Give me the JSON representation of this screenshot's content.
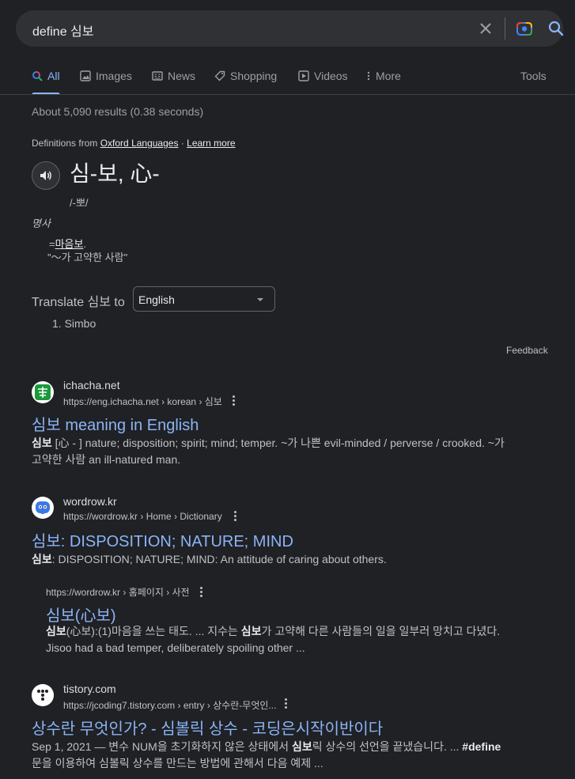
{
  "search": {
    "query": "define 심보"
  },
  "tabs": {
    "items": [
      "All",
      "Images",
      "News",
      "Shopping",
      "Videos",
      "More"
    ],
    "tools": "Tools"
  },
  "stats": "About 5,090 results (0.38 seconds)",
  "dictionary": {
    "source_prefix": "Definitions from",
    "source_name": "Oxford Languages",
    "separator": "·",
    "learn_more": "Learn more",
    "headword": "심-보, 心-",
    "phonetic": "/-뽀/",
    "part_of_speech": "명사",
    "def_prefix": "=",
    "def_link": "마음보",
    "def_suffix": ".",
    "example": "\"～가 고약한 사람\"",
    "translate_label": "Translate 심보 to",
    "language": "English",
    "translation": "1. Simbo",
    "feedback": "Feedback"
  },
  "results": [
    {
      "site": "ichacha.net",
      "url": "https://eng.ichacha.net › korean › 심보",
      "title": "심보 meaning in English",
      "snippet_bold": "심보",
      "snippet_rest": " [心 - ] nature; disposition; spirit; mind; temper. ~가 나쁜 evil-minded / perverse / crooked. ~가 고약한 사람 an ill-natured man."
    },
    {
      "site": "wordrow.kr",
      "url": "https://wordrow.kr › Home › Dictionary",
      "title": "심보: DISPOSITION; NATURE; MIND",
      "snippet_bold": "심보",
      "snippet_rest": ": DISPOSITION; NATURE; MIND: An attitude of caring about others.",
      "sub": {
        "url": "https://wordrow.kr › 홈페이지 › 사전",
        "title": "심보(心보)",
        "snippet_b1": "심보",
        "snippet_t1": "(心보):(1)마음을 쓰는 태도. ... 지수는 ",
        "snippet_b2": "심보",
        "snippet_t2": "가 고약해 다른 사람들의 일을 일부러 망치고 다녔다. Jisoo had a bad temper, deliberately spoiling other ..."
      }
    },
    {
      "site": "tistory.com",
      "url": "https://jcoding7.tistory.com › entry › 상수란-무엇인...",
      "title": "상수란 무엇인가? - 심볼릭 상수 - 코딩은시작이반이다",
      "snippet_t1": "Sep 1, 2021 — 변수 NUM을 초기화하지 않은 상태에서 ",
      "snippet_b1": "심보",
      "snippet_t2": "릭 상수의 선언을 끝냈습니다. ... ",
      "snippet_b2": "#define",
      "snippet_t3": " 문을 이용하여 심볼릭 상수를 만드는 방법에 관해서 다음 예제 ..."
    }
  ],
  "colors": {
    "background": "#202124",
    "link": "#8ab4f8",
    "text": "#bdc1c6",
    "searchbar": "#303134"
  }
}
